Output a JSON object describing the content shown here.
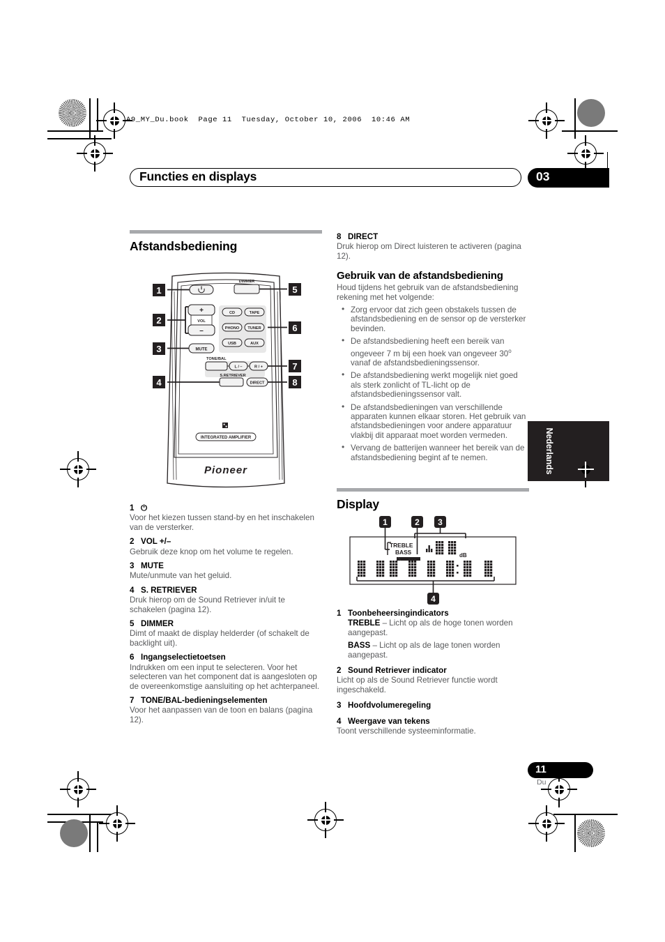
{
  "page": {
    "filename_line": "A9_MY_Du.book  Page 11  Tuesday, October 10, 2006  10:46 AM",
    "header_title": "Functies en displays",
    "chapter_number": "03",
    "side_tab": "Nederlands",
    "page_number": "11",
    "page_lang": "Du"
  },
  "left_column": {
    "section_title": "Afstandsbediening",
    "callouts": [
      "1",
      "2",
      "3",
      "4",
      "5",
      "6",
      "7",
      "8"
    ],
    "items": [
      {
        "num": "1",
        "label": "⏻",
        "body": "Voor het kiezen tussen stand-by en het inschakelen van de versterker."
      },
      {
        "num": "2",
        "label": "VOL +/–",
        "body": "Gebruik deze knop om het volume te regelen."
      },
      {
        "num": "3",
        "label": "MUTE",
        "body": "Mute/unmute van het geluid."
      },
      {
        "num": "4",
        "label": "S. RETRIEVER",
        "body": "Druk hierop om de Sound Retriever in/uit te schakelen (pagina 12)."
      },
      {
        "num": "5",
        "label": "DIMMER",
        "body": "Dimt of maakt de display helderder (of schakelt de backlight uit)."
      },
      {
        "num": "6",
        "label": "Ingangselectietoetsen",
        "body": "Indrukken om een input te selecteren. Voor het selecteren van het component dat is aangesloten op de overeenkomstige aansluiting op het achterpaneel."
      },
      {
        "num": "7",
        "label": "TONE/BAL-bedieningselementen",
        "body": "Voor het aanpassen van de toon en balans (pagina 12)."
      }
    ]
  },
  "remote": {
    "power_label": "⏻",
    "dimmer_label": "DIMMER",
    "vol_plus": "+",
    "vol_minus": "–",
    "vol_label": "VOL",
    "mute_label": "MUTE",
    "input_buttons": [
      "CD",
      "TAPE",
      "PHONO",
      "TUNER",
      "USB",
      "AUX"
    ],
    "tone_bal_label": "TONE/BAL",
    "tone_left": "L / –",
    "tone_right": "R / +",
    "s_retriever_label": "S.RETRIEVER",
    "direct_label": "DIRECT",
    "model_label": "INTEGRATED AMPLIFIER",
    "brand": "Pioneer"
  },
  "right_column": {
    "item8": {
      "num": "8",
      "label": "DIRECT",
      "body": "Druk hierop om Direct luisteren te activeren (pagina 12)."
    },
    "usage_heading": "Gebruik van de afstandsbediening",
    "usage_intro": "Houd tijdens het gebruik van de afstandsbediening rekening met het volgende:",
    "usage_bullets": [
      "Zorg ervoor dat zich geen obstakels tussen de afstandsbediening en de sensor op de versterker bevinden.",
      "De afstandsbediening heeft een bereik van ongeveer 7 m bij een hoek van ongeveer 30º vanaf de afstandsbedieningssensor.",
      "De afstandsbediening werkt mogelijk niet goed als sterk zonlicht of TL-licht op de afstandsbedieningssensor valt.",
      "De afstandsbedieningen van verschillende apparaten kunnen elkaar storen. Het gebruik van afstandsbedieningen voor andere apparatuur vlakbij dit apparaat moet worden vermeden.",
      "Vervang de batterijen wanneer het bereik van de afstandsbediening begint af te nemen."
    ],
    "display_heading": "Display",
    "display_callouts": [
      "1",
      "2",
      "3",
      "4"
    ],
    "display_labels": {
      "treble": "TREBLE",
      "bass": "BASS",
      "db": "dB"
    },
    "display_items": [
      {
        "num": "1",
        "label": "Toonbeheersingindicators",
        "para1_bold": "TREBLE",
        "para1_rest": " – Licht op als de hoge tonen worden aangepast.",
        "para2_bold": "BASS",
        "para2_rest": " – Licht op als de lage tonen worden aangepast."
      },
      {
        "num": "2",
        "label": "Sound Retriever indicator",
        "body": "Licht op als de Sound Retriever functie wordt ingeschakeld."
      },
      {
        "num": "3",
        "label": "Hoofdvolumeregeling",
        "body": ""
      },
      {
        "num": "4",
        "label": "Weergave van tekens",
        "body": "Toont verschillende systeeminformatie."
      }
    ]
  }
}
